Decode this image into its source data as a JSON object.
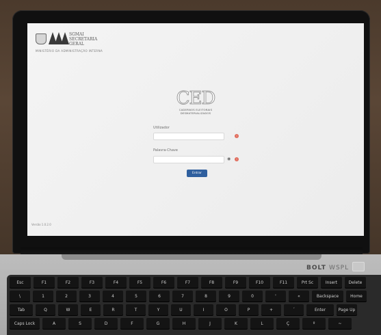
{
  "header": {
    "org_line1": "SGMAI",
    "org_line2": "SECRETARIA",
    "org_line3": "GERAL",
    "ministry": "MINISTÉRIO DA ADMINISTRAÇÃO INTERNA"
  },
  "app": {
    "logo_text": "CED",
    "subtitle_line1": "CADERNOS ELEITORAIS",
    "subtitle_line2": "DESMATERIALIZADOS"
  },
  "form": {
    "user_label": "Utilizador",
    "user_value": "",
    "password_label": "Palavra-Chave",
    "password_value": "",
    "submit_label": "Entrar"
  },
  "footer": {
    "version": "Versão 1.0.2.0"
  },
  "device": {
    "brand_bold": "BOLT",
    "brand_thin": "WSPL"
  },
  "keyboard": {
    "row1": [
      "Esc",
      "F1",
      "F2",
      "F3",
      "F4",
      "F5",
      "F6",
      "F7",
      "F8",
      "F9",
      "F10",
      "F11",
      "Prt Sc",
      "Insert",
      "Delete"
    ],
    "row2": [
      "\\",
      "1",
      "2",
      "3",
      "4",
      "5",
      "6",
      "7",
      "8",
      "9",
      "0",
      "'",
      "«",
      "Backspace",
      "Home"
    ],
    "row3": [
      "Tab",
      "Q",
      "W",
      "E",
      "R",
      "T",
      "Y",
      "U",
      "I",
      "O",
      "P",
      "+",
      "´",
      "Enter",
      "Page Up"
    ],
    "row4": [
      "Caps Lock",
      "A",
      "S",
      "D",
      "F",
      "G",
      "H",
      "J",
      "K",
      "L",
      "Ç",
      "º",
      "~"
    ]
  },
  "colors": {
    "button": "#2f5f9e",
    "alert": "#e06a5a",
    "screen": "#f1f1f1"
  },
  "icons": {
    "field_alert": "exclamation-circle",
    "password_toggle": "eye"
  }
}
